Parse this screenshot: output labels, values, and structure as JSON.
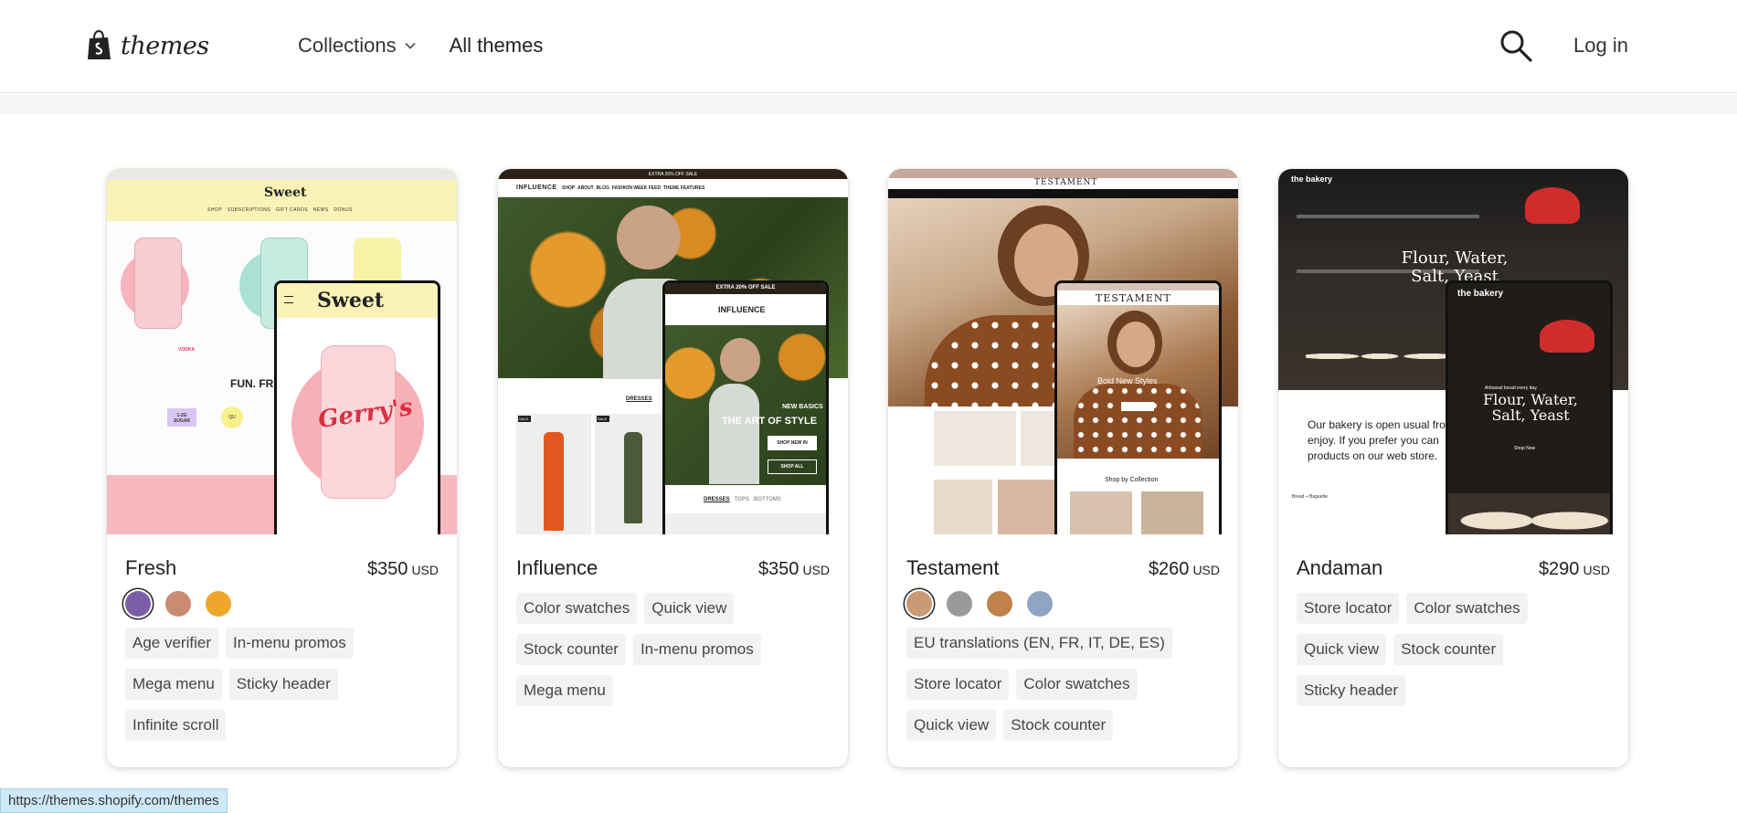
{
  "header": {
    "logo_text": "themes",
    "nav": {
      "collections_label": "Collections",
      "all_themes_label": "All themes"
    },
    "login_label": "Log in"
  },
  "themes": [
    {
      "name": "Fresh",
      "price": "$350",
      "currency": "USD",
      "swatches": [
        "#7b5ea7",
        "#c98b72",
        "#eea62b"
      ],
      "selected_swatch": 0,
      "tags": [
        "Age verifier",
        "In-menu promos",
        "Mega menu",
        "Sticky header",
        "Infinite scroll"
      ],
      "preview": {
        "brand": "Sweet",
        "product": "Gerry's",
        "headline": "FUN. FRE",
        "nav_items": [
          "SHOP",
          "SUBSCRIPTIONS",
          "GIFT CARDS",
          "NEWS",
          "DONUS"
        ],
        "badges": [
          "1-2G SUGAR",
          "QU"
        ],
        "product_label": "VODKA"
      }
    },
    {
      "name": "Influence",
      "price": "$350",
      "currency": "USD",
      "swatches": [],
      "tags": [
        "Color swatches",
        "Quick view",
        "Stock counter",
        "In-menu promos",
        "Mega menu"
      ],
      "preview": {
        "brand": "INFLUENCE",
        "banner": "EXTRA 20% OFF SALE",
        "kicker": "NEW BASICS",
        "headline": "THE ART OF STYLE",
        "cta": "SHOP NEW IN",
        "cta2": "SHOP ALL",
        "tabs": [
          "DRESSES",
          "TOPS",
          "BOTTOMS"
        ],
        "nav_items": [
          "SHOP",
          "ABOUT",
          "BLOG",
          "FASHION WEEK FEED",
          "THEME FEATURES"
        ],
        "sale": "SALE"
      }
    },
    {
      "name": "Testament",
      "price": "$260",
      "currency": "USD",
      "swatches": [
        "#c99a74",
        "#999999",
        "#c0814a",
        "#8ea6c4"
      ],
      "selected_swatch": 0,
      "tags": [
        "EU translations (EN, FR, IT, DE, ES)",
        "Store locator",
        "Color swatches",
        "Quick view",
        "Stock counter"
      ],
      "preview": {
        "brand": "TESTAMENT",
        "headline": "Bold New Styles",
        "shop_by": "Shop by Collection"
      }
    },
    {
      "name": "Andaman",
      "price": "$290",
      "currency": "USD",
      "swatches": [],
      "tags": [
        "Store locator",
        "Color swatches",
        "Quick view",
        "Stock counter",
        "Sticky header"
      ],
      "preview": {
        "brand": "the bakery",
        "kicker": "Artisanal bread every day.",
        "headline": "Flour, Water, Salt, Yeast",
        "body": "Our bakery is open usual fro enjoy. If you prefer you can products on our web store.",
        "cta": "Shop Now",
        "label": "Bread + Baguette"
      }
    }
  ],
  "status_bar": {
    "url": "https://themes.shopify.com/themes"
  }
}
